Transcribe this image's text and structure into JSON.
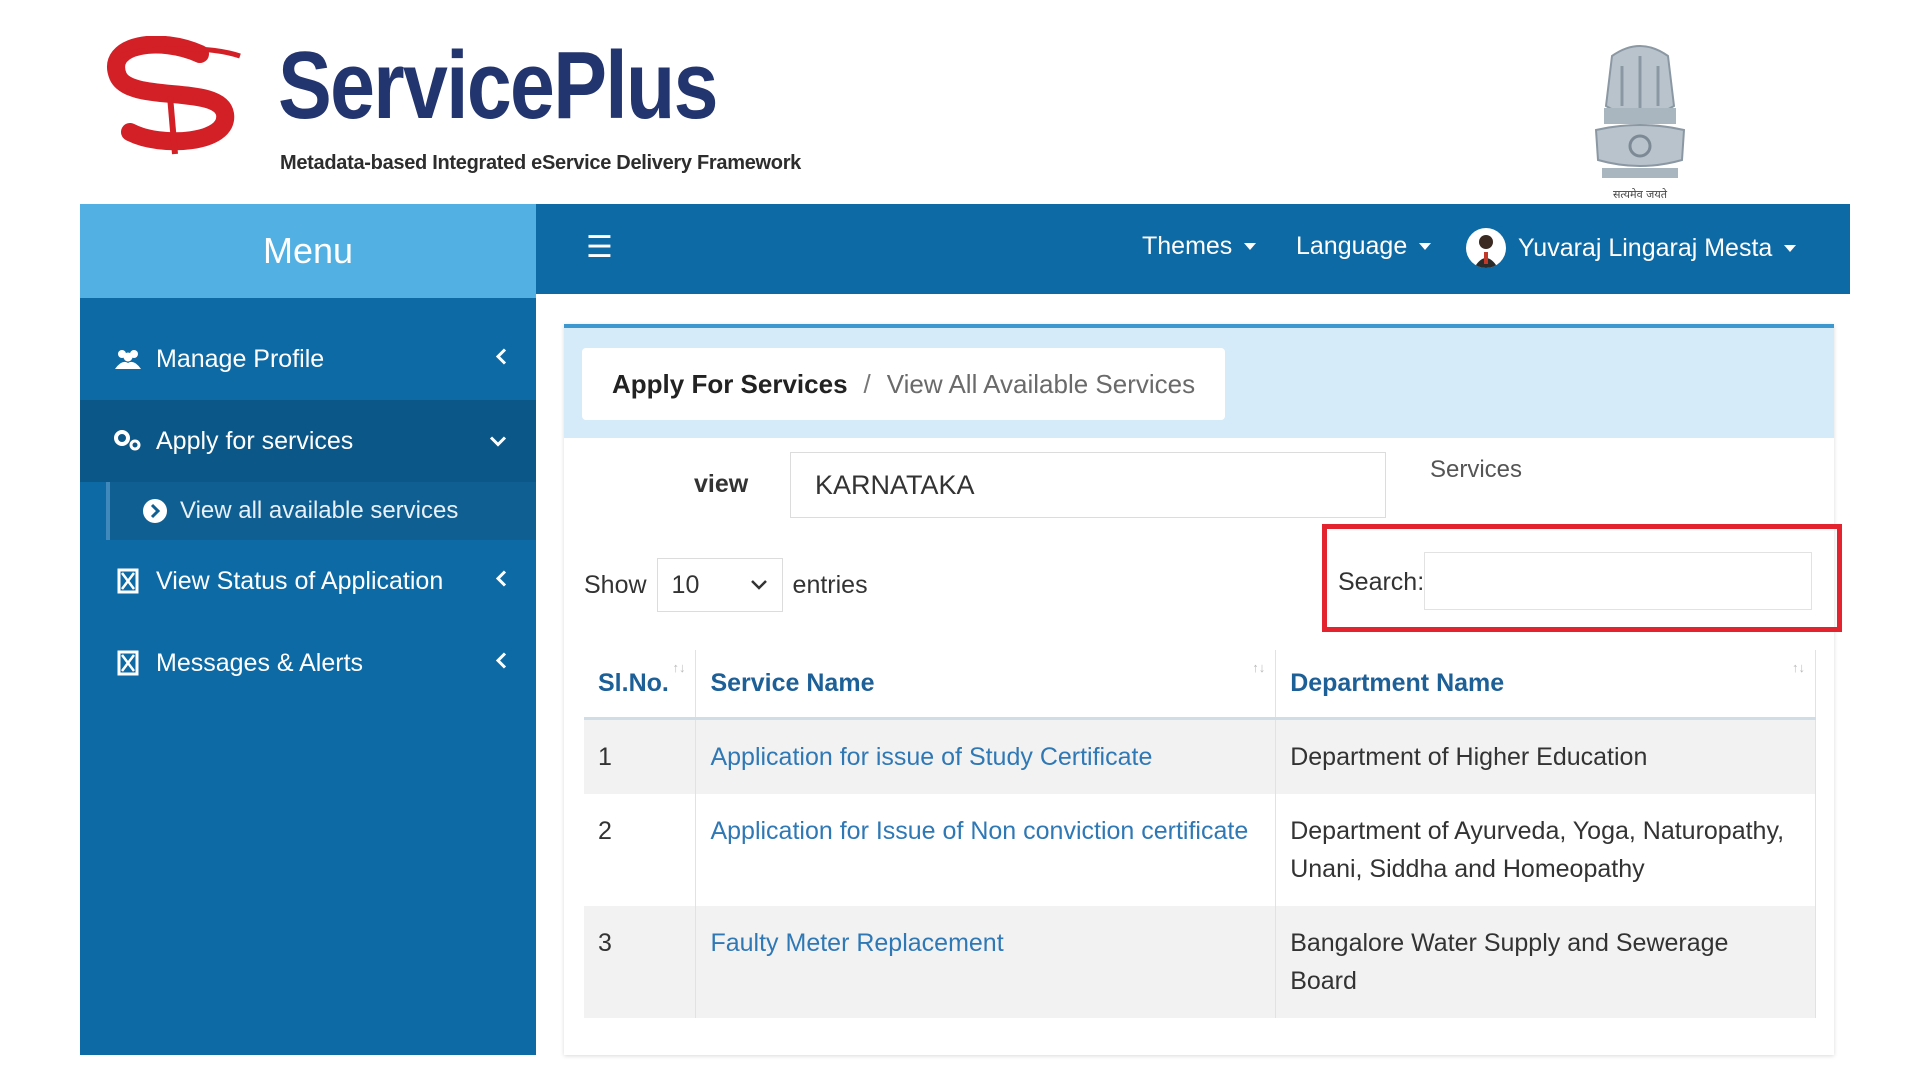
{
  "brand": {
    "name": "ServicePlus",
    "tagline": "Metadata-based Integrated eService Delivery Framework",
    "emblem_motto": "सत्यमेव जयते"
  },
  "sidebar": {
    "title": "Menu",
    "items": [
      {
        "label": "Manage Profile",
        "icon": "users-icon",
        "chevron": "chevron-left-icon"
      },
      {
        "label": "Apply for services",
        "icon": "gears-icon",
        "chevron": "chevron-down-icon"
      },
      {
        "label": "View all available services",
        "icon": "circle-arrow-icon"
      },
      {
        "label": "View Status of Application",
        "icon": "hourglass-icon",
        "chevron": "chevron-left-icon"
      },
      {
        "label": "Messages & Alerts",
        "icon": "hourglass-icon",
        "chevron": "chevron-left-icon"
      }
    ]
  },
  "topbar": {
    "menu_icon": "hamburger-icon",
    "themes": "Themes",
    "language": "Language",
    "user": "Yuvaraj Lingaraj Mesta"
  },
  "breadcrumb": {
    "parent": "Apply For Services",
    "separator": "/",
    "current": "View All Available Services"
  },
  "filter": {
    "view_label": "view",
    "state_value": "KARNATAKA",
    "services_label": "Services"
  },
  "table_controls": {
    "show_label": "Show",
    "entries_value": "10",
    "entries_label": "entries",
    "search_label": "Search:",
    "search_value": ""
  },
  "table": {
    "headers": [
      "Sl.No.",
      "Service Name",
      "Department Name"
    ],
    "rows": [
      {
        "no": "1",
        "service": "Application for issue of Study Certificate",
        "dept": "Department of Higher Education"
      },
      {
        "no": "2",
        "service": "Application for Issue of Non conviction certificate",
        "dept": "Department of Ayurveda, Yoga, Naturopathy, Unani, Siddha and Homeopathy"
      },
      {
        "no": "3",
        "service": "Faulty Meter Replacement",
        "dept": "Bangalore Water Supply and Sewerage Board"
      }
    ]
  },
  "colors": {
    "sidebar": "#0e6aa4",
    "menu_head": "#52b0e2",
    "highlight": "#e3232d",
    "link": "#2f78b6"
  }
}
